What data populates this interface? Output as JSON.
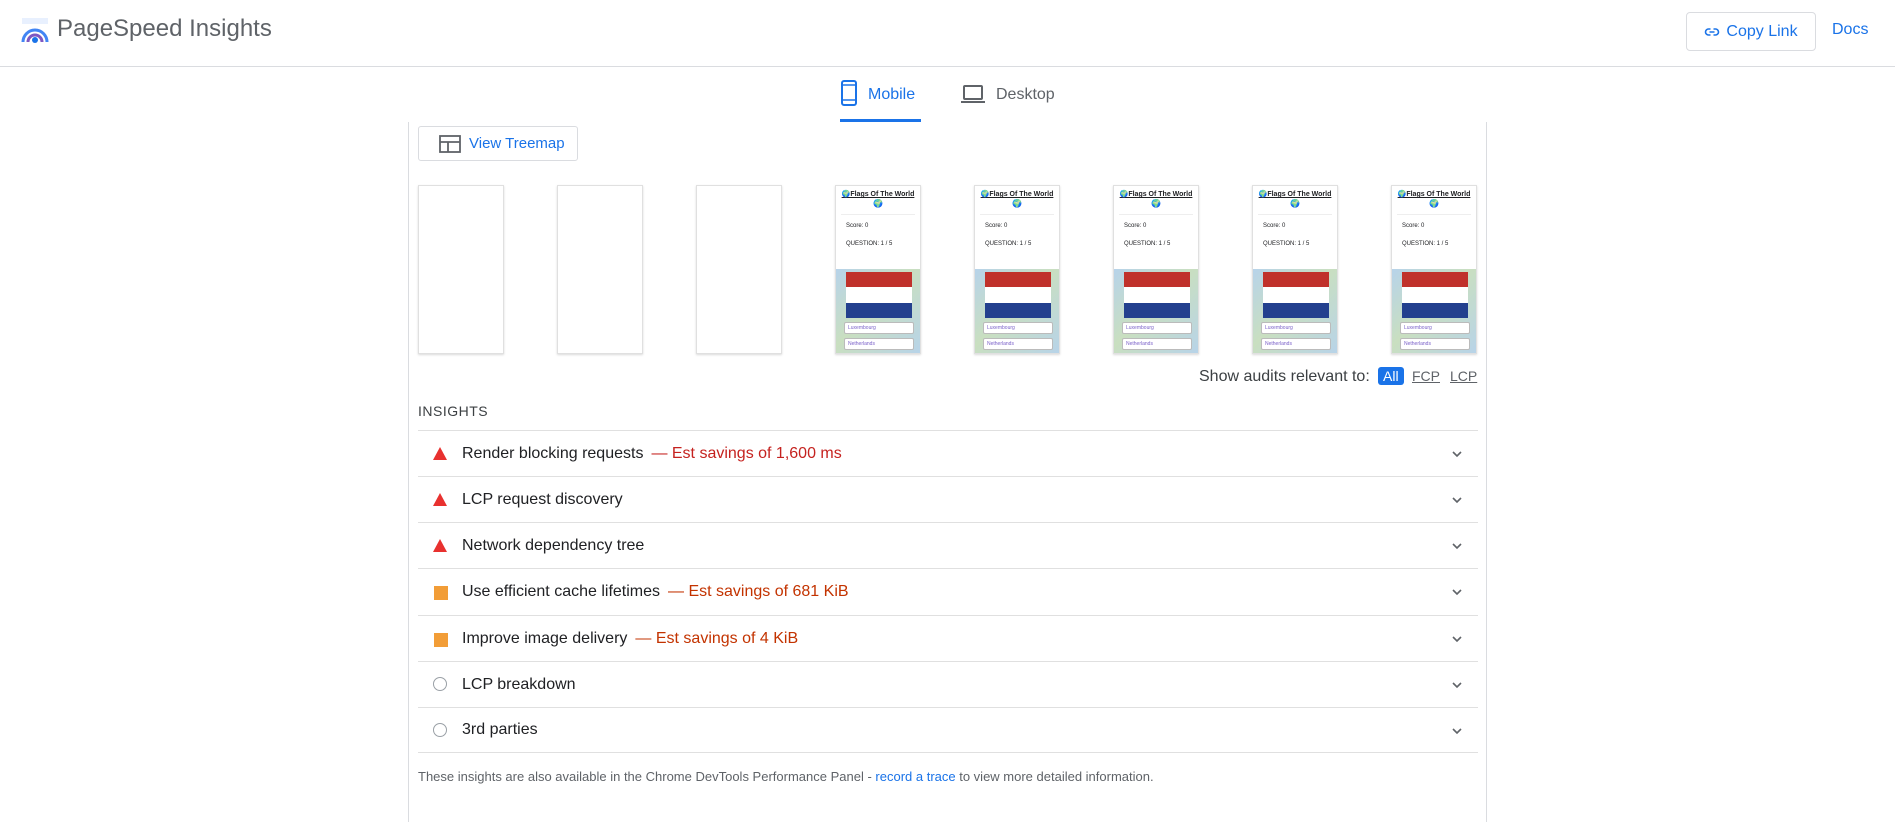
{
  "header": {
    "title": "PageSpeed Insights",
    "copy_link_label": "Copy Link",
    "docs_label": "Docs"
  },
  "tabs": [
    {
      "label": "Mobile",
      "active": true
    },
    {
      "label": "Desktop",
      "active": false
    }
  ],
  "treemap_label": "View Treemap",
  "filmstrip": {
    "blank_frames": 3,
    "content_frames": 5,
    "frame_title": "Flags Of The World",
    "score_label": "Score:",
    "score_value": "0",
    "question_text": "QUESTION: 1 / 5",
    "option_1": "Luxembourg",
    "option_2": "Netherlands",
    "flag_colors": [
      "#c0312b",
      "#ffffff",
      "#23408e"
    ]
  },
  "filters": {
    "label": "Show audits relevant to:",
    "options": [
      "All",
      "FCP",
      "LCP"
    ],
    "selected": "All"
  },
  "insights": {
    "heading": "INSIGHTS",
    "items": [
      {
        "title": "Render blocking requests",
        "savings": "— Est savings of 1,600 ms",
        "severity": "fail"
      },
      {
        "title": "LCP request discovery",
        "savings": "",
        "severity": "fail"
      },
      {
        "title": "Network dependency tree",
        "savings": "",
        "severity": "fail"
      },
      {
        "title": "Use efficient cache lifetimes",
        "savings": "— Est savings of 681 KiB",
        "severity": "average"
      },
      {
        "title": "Improve image delivery",
        "savings": "— Est savings of 4 KiB",
        "severity": "average"
      },
      {
        "title": "LCP breakdown",
        "savings": "",
        "severity": "info"
      },
      {
        "title": "3rd parties",
        "savings": "",
        "severity": "info"
      }
    ]
  },
  "footer": {
    "text_before": "These insights are also available in the Chrome DevTools Performance Panel - ",
    "link_text": "record a trace",
    "text_after": " to view more detailed information."
  },
  "colors": {
    "accent": "#1a73e8",
    "fail": "#e8312f",
    "average": "#f29d37",
    "savings_red": "#c5221f"
  }
}
